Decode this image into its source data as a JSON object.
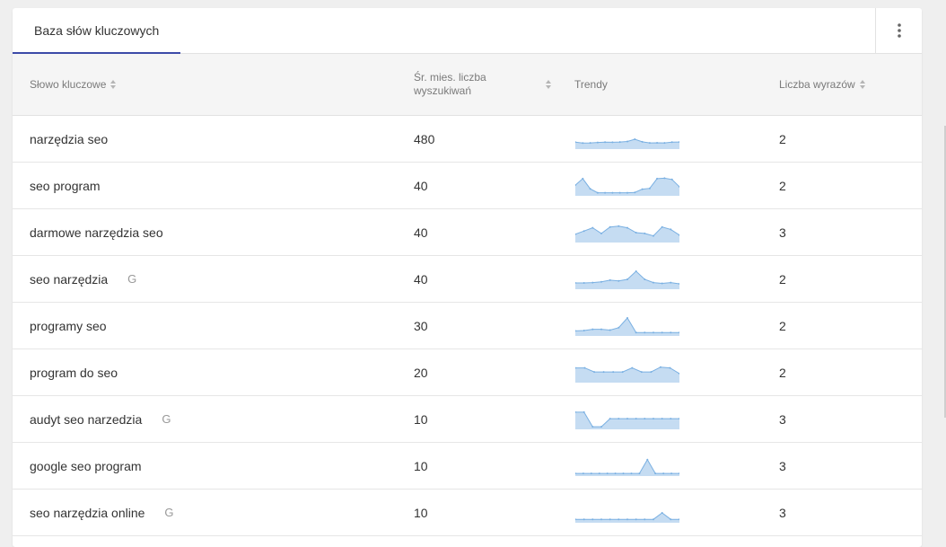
{
  "tabs": [
    {
      "label": "Baza słów kluczowych",
      "active": true
    }
  ],
  "menu_icon": "more-vertical-icon",
  "columns": {
    "keyword": "Słowo kluczowe",
    "volume": "Śr. mies. liczba wyszukiwań",
    "trends": "Trendy",
    "words": "Liczba wyrazów"
  },
  "colors": {
    "accent": "#3c4aa8",
    "trend_fill": "#c5dcf2",
    "trend_line": "#7ab0e2"
  },
  "rows": [
    {
      "keyword": "narzędzia seo",
      "google": "",
      "volume": "480",
      "words": "2",
      "trend": [
        0.32,
        0.26,
        0.27,
        0.3,
        0.32,
        0.31,
        0.33,
        0.36,
        0.5,
        0.34,
        0.27,
        0.28,
        0.27,
        0.32,
        0.33
      ]
    },
    {
      "keyword": "seo program",
      "google": "",
      "volume": "40",
      "words": "2",
      "trend": [
        0.55,
        0.95,
        0.32,
        0.08,
        0.08,
        0.08,
        0.08,
        0.08,
        0.1,
        0.3,
        0.35,
        0.95,
        0.98,
        0.9,
        0.45
      ]
    },
    {
      "keyword": "darmowe narzędzia seo",
      "google": "",
      "volume": "40",
      "words": "3",
      "trend": [
        0.4,
        0.6,
        0.8,
        0.45,
        0.85,
        0.9,
        0.8,
        0.5,
        0.45,
        0.3,
        0.85,
        0.7,
        0.35
      ]
    },
    {
      "keyword": "seo narzędzia",
      "google": "G",
      "volume": "40",
      "words": "2",
      "trend": [
        0.28,
        0.28,
        0.3,
        0.35,
        0.45,
        0.4,
        0.5,
        1.0,
        0.5,
        0.3,
        0.25,
        0.3,
        0.22
      ]
    },
    {
      "keyword": "programy seo",
      "google": "",
      "volume": "30",
      "words": "2",
      "trend": [
        0.2,
        0.22,
        0.3,
        0.3,
        0.25,
        0.4,
        1.0,
        0.1,
        0.1,
        0.1,
        0.1,
        0.1,
        0.1
      ]
    },
    {
      "keyword": "program do seo",
      "google": "",
      "volume": "20",
      "words": "2",
      "trend": [
        0.8,
        0.8,
        0.55,
        0.55,
        0.55,
        0.55,
        0.8,
        0.55,
        0.55,
        0.85,
        0.8,
        0.45
      ]
    },
    {
      "keyword": "audyt seo narzedzia",
      "google": "G",
      "volume": "10",
      "words": "3",
      "trend": [
        0.95,
        0.95,
        0.05,
        0.05,
        0.55,
        0.55,
        0.55,
        0.55,
        0.55,
        0.55,
        0.55,
        0.55,
        0.55
      ]
    },
    {
      "keyword": "google seo program",
      "google": "",
      "volume": "10",
      "words": "3",
      "trend": [
        0.05,
        0.05,
        0.05,
        0.05,
        0.05,
        0.05,
        0.05,
        0.05,
        0.05,
        0.9,
        0.05,
        0.05,
        0.05,
        0.05
      ]
    },
    {
      "keyword": "seo narzędzia online",
      "google": "G",
      "volume": "10",
      "words": "3",
      "trend": [
        0.1,
        0.1,
        0.1,
        0.1,
        0.1,
        0.1,
        0.1,
        0.1,
        0.1,
        0.1,
        0.5,
        0.1,
        0.1
      ]
    }
  ]
}
